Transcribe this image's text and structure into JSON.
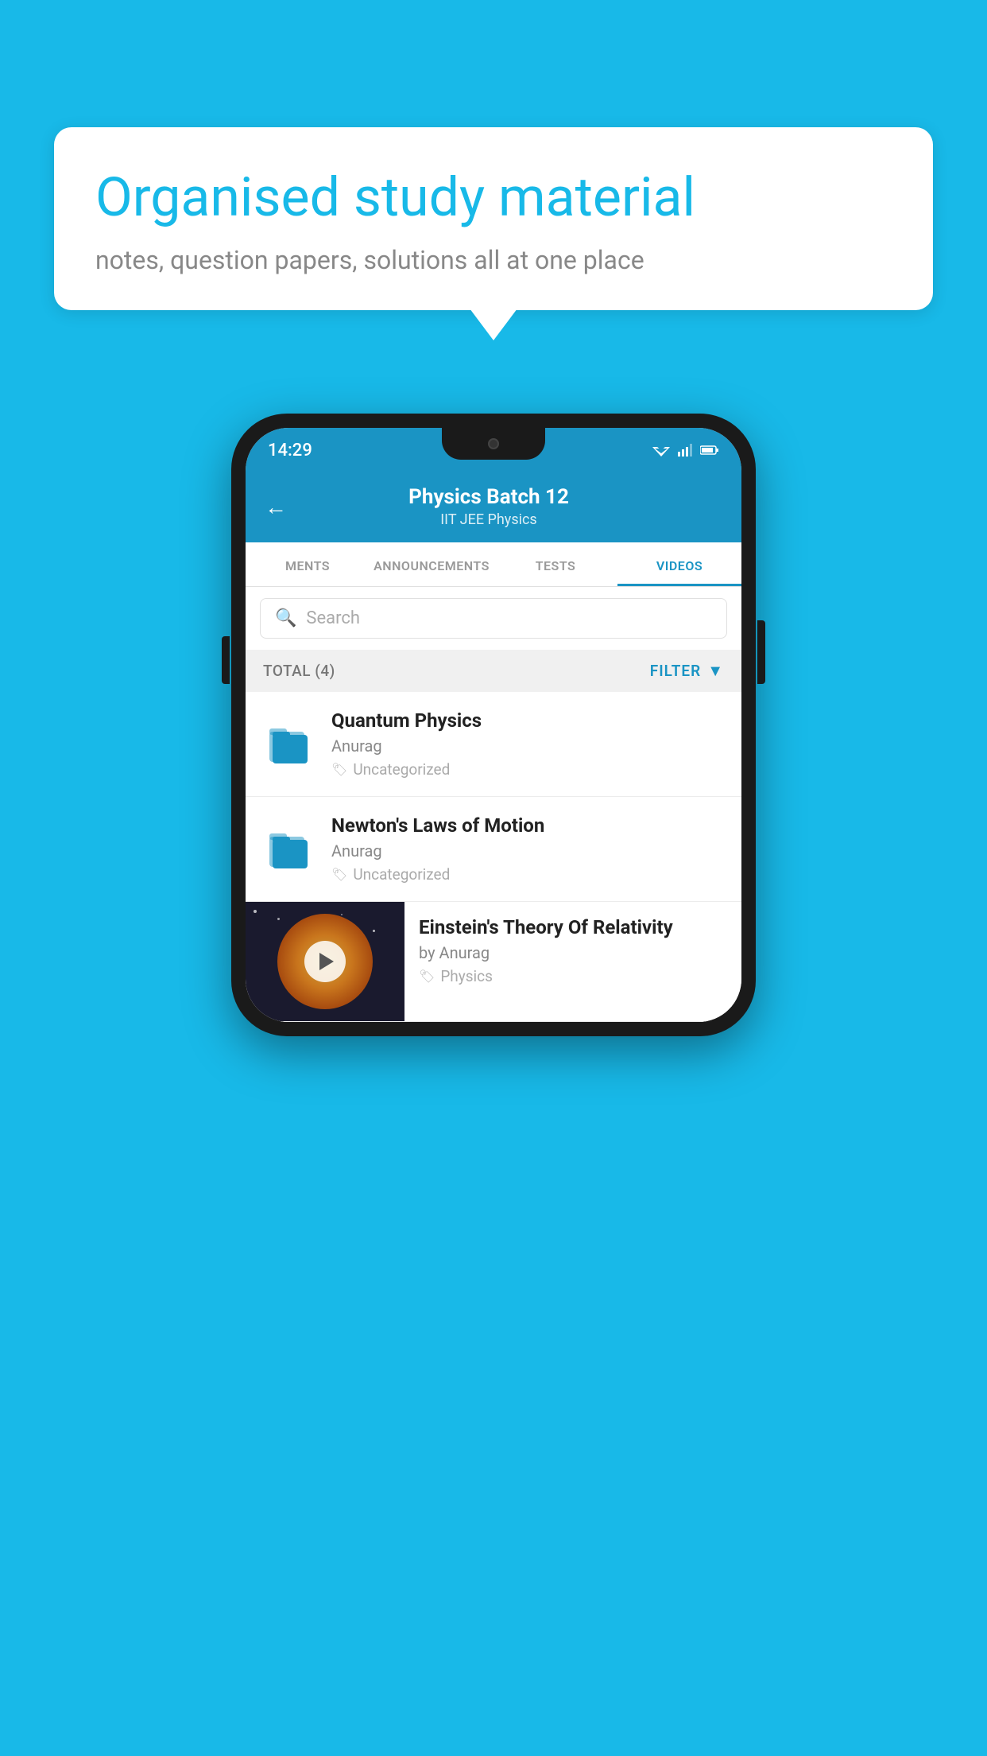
{
  "background_color": "#18b9e8",
  "speech_bubble": {
    "title": "Organised study material",
    "subtitle": "notes, question papers, solutions all at one place"
  },
  "phone": {
    "status_bar": {
      "time": "14:29"
    },
    "app_header": {
      "title": "Physics Batch 12",
      "subtitle_tags": "IIT JEE   Physics",
      "back_label": "←"
    },
    "tabs": [
      {
        "label": "MENTS",
        "active": false
      },
      {
        "label": "ANNOUNCEMENTS",
        "active": false
      },
      {
        "label": "TESTS",
        "active": false
      },
      {
        "label": "VIDEOS",
        "active": true
      }
    ],
    "search": {
      "placeholder": "Search"
    },
    "filter_bar": {
      "total_label": "TOTAL (4)",
      "filter_label": "FILTER"
    },
    "videos": [
      {
        "type": "folder",
        "title": "Quantum Physics",
        "author": "Anurag",
        "tag": "Uncategorized"
      },
      {
        "type": "folder",
        "title": "Newton's Laws of Motion",
        "author": "Anurag",
        "tag": "Uncategorized"
      },
      {
        "type": "thumbnail",
        "title": "Einstein's Theory Of Relativity",
        "author": "by Anurag",
        "tag": "Physics"
      }
    ]
  }
}
